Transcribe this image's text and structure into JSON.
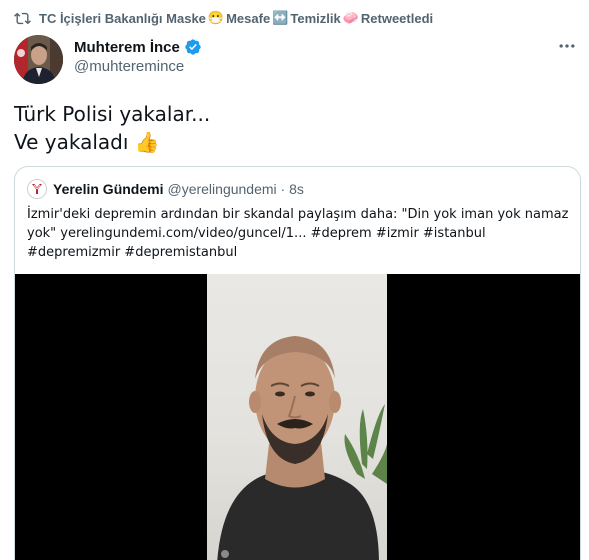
{
  "retweet": {
    "icon": "retweet-icon",
    "label_start": "TC İçişleri Bakanlığı Maske",
    "emoji1": "😷",
    "label_mid1": " Mesafe",
    "emoji2": "↔️",
    "label_mid2": " Temizlik",
    "emoji3": "🧼",
    "label_end": " Retweetledi"
  },
  "author": {
    "name": "Muhterem İnce",
    "handle": "@muhteremince",
    "verified_icon": "verified-badge-icon"
  },
  "tweet": {
    "line1": "Türk Polisi yakalar...",
    "line2": "Ve yakaladı",
    "emoji": "👍"
  },
  "quoted": {
    "name": "Yerelin Gündemi",
    "meta": "@yerelingundemi · 8s",
    "lines": [
      "İzmir'deki depremin ardından bir skandal paylaşım daha: \"Din yok iman yok namaz",
      "yok\" yerelingundemi.com/video/guncel/1... #deprem #izmir #istanbul",
      "#depremizmir #depremistanbul"
    ]
  },
  "colors": {
    "text": "#0f1419",
    "secondary": "#536471",
    "verified": "#1d9bf0",
    "border": "#cfd9de",
    "video_bg": "#000000"
  }
}
